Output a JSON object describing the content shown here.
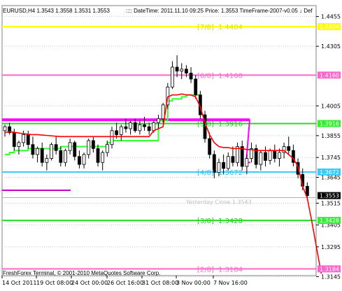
{
  "header": {
    "symbol_line": "EURUSD,H4  1.3543 1.3558 1.3531 1.3553",
    "info_line": ":::: DateTime: 2011.11.10 09:25   Price: 1.3553   TimeFrame-2007-v0.05   ↓  Def"
  },
  "footer": {
    "copyright": "FreshForex Terminal, © 2001-2010 MetaQuotes Software Corp."
  },
  "chart_data": {
    "type": "candlestick",
    "symbol": "EURUSD",
    "timeframe": "H4",
    "ylim": [
      1.315,
      1.451
    ],
    "yticks": [
      1.4455,
      1.4305,
      1.4005,
      1.3855,
      1.3745,
      1.3645,
      1.3515,
      1.3405,
      1.3295,
      1.3145
    ],
    "xticks": [
      "14 Oct 2011",
      "19 Oct 08:00",
      "24 Oct 00:00",
      "26 Oct 16:00",
      "31 Oct 08:00",
      "3 Nov 00:00",
      "7 Nov 16:00"
    ],
    "price_labels": [
      {
        "value": "1.4404",
        "color": "#ffff00",
        "text_color": "#ffffff"
      },
      {
        "value": "1.4160",
        "color": "#ff66cc",
        "text_color": "#ffffff"
      },
      {
        "value": "1.3916",
        "color": "#33ee33",
        "text_color": "#ffffff"
      },
      {
        "value": "1.3672",
        "color": "#33ccff",
        "text_color": "#ffffff"
      },
      {
        "value": "1.3553",
        "color": "#000000",
        "text_color": "#ffffff"
      },
      {
        "value": "1.3428",
        "color": "#33ee33",
        "text_color": "#ffffff"
      },
      {
        "value": "1.3184",
        "color": "#ff66cc",
        "text_color": "#ffffff"
      }
    ],
    "murrey_levels": [
      {
        "label": "[7/8]",
        "value": "1.4404",
        "price": 1.4404,
        "color": "#ffff00",
        "text_color": "#dddd00"
      },
      {
        "label": "[6/8]",
        "value": "1.4160",
        "price": 1.416,
        "color": "#ff66cc",
        "text_color": "#ff66cc"
      },
      {
        "label": "[5/8]",
        "value": "1.3916",
        "price": 1.3916,
        "color": "#22dd22",
        "text_color": "#22cc22"
      },
      {
        "label": "[4/8]",
        "value": "1.3672",
        "price": 1.3672,
        "color": "#33ccff",
        "text_color": "#33bbee"
      },
      {
        "label": "[3/8]",
        "value": "1.3428",
        "price": 1.3428,
        "color": "#22dd22",
        "text_color": "#22cc22"
      },
      {
        "label": "[2/8]",
        "value": "1.3184",
        "price": 1.3184,
        "color": "#ff66cc",
        "text_color": "#ff66cc"
      }
    ],
    "yesterday_close": {
      "label": "Yesterday Close",
      "value": "1.3543",
      "price": 1.3543
    },
    "magenta_level": 1.3935,
    "candles": [
      [
        1.388,
        1.391,
        1.385,
        1.39
      ],
      [
        1.39,
        1.392,
        1.386,
        1.387
      ],
      [
        1.387,
        1.389,
        1.378,
        1.38
      ],
      [
        1.38,
        1.383,
        1.376,
        1.382
      ],
      [
        1.382,
        1.388,
        1.38,
        1.386
      ],
      [
        1.386,
        1.388,
        1.379,
        1.381
      ],
      [
        1.381,
        1.385,
        1.374,
        1.376
      ],
      [
        1.376,
        1.38,
        1.372,
        1.379
      ],
      [
        1.379,
        1.382,
        1.37,
        1.372
      ],
      [
        1.372,
        1.376,
        1.368,
        1.374
      ],
      [
        1.374,
        1.382,
        1.373,
        1.381
      ],
      [
        1.381,
        1.385,
        1.376,
        1.378
      ],
      [
        1.378,
        1.38,
        1.37,
        1.372
      ],
      [
        1.372,
        1.379,
        1.37,
        1.378
      ],
      [
        1.378,
        1.384,
        1.376,
        1.382
      ],
      [
        1.382,
        1.383,
        1.373,
        1.375
      ],
      [
        1.375,
        1.378,
        1.369,
        1.371
      ],
      [
        1.371,
        1.377,
        1.369,
        1.376
      ],
      [
        1.376,
        1.384,
        1.374,
        1.383
      ],
      [
        1.383,
        1.385,
        1.377,
        1.379
      ],
      [
        1.379,
        1.381,
        1.37,
        1.372
      ],
      [
        1.372,
        1.378,
        1.368,
        1.377
      ],
      [
        1.377,
        1.383,
        1.375,
        1.381
      ],
      [
        1.381,
        1.39,
        1.379,
        1.388
      ],
      [
        1.388,
        1.392,
        1.384,
        1.386
      ],
      [
        1.386,
        1.391,
        1.383,
        1.39
      ],
      [
        1.39,
        1.394,
        1.387,
        1.389
      ],
      [
        1.389,
        1.393,
        1.386,
        1.392
      ],
      [
        1.392,
        1.394,
        1.387,
        1.388
      ],
      [
        1.388,
        1.393,
        1.386,
        1.391
      ],
      [
        1.391,
        1.395,
        1.388,
        1.39
      ],
      [
        1.39,
        1.392,
        1.386,
        1.388
      ],
      [
        1.388,
        1.393,
        1.387,
        1.392
      ],
      [
        1.392,
        1.396,
        1.389,
        1.394
      ],
      [
        1.394,
        1.402,
        1.392,
        1.401
      ],
      [
        1.401,
        1.412,
        1.399,
        1.41
      ],
      [
        1.41,
        1.423,
        1.409,
        1.42
      ],
      [
        1.42,
        1.426,
        1.415,
        1.418
      ],
      [
        1.418,
        1.422,
        1.414,
        1.419
      ],
      [
        1.419,
        1.421,
        1.415,
        1.417
      ],
      [
        1.417,
        1.42,
        1.412,
        1.414
      ],
      [
        1.414,
        1.416,
        1.404,
        1.406
      ],
      [
        1.406,
        1.408,
        1.394,
        1.396
      ],
      [
        1.396,
        1.398,
        1.382,
        1.384
      ],
      [
        1.384,
        1.387,
        1.374,
        1.376
      ],
      [
        1.376,
        1.378,
        1.364,
        1.367
      ],
      [
        1.367,
        1.374,
        1.365,
        1.372
      ],
      [
        1.372,
        1.376,
        1.366,
        1.369
      ],
      [
        1.369,
        1.377,
        1.368,
        1.375
      ],
      [
        1.375,
        1.38,
        1.37,
        1.372
      ],
      [
        1.372,
        1.382,
        1.37,
        1.38
      ],
      [
        1.38,
        1.383,
        1.368,
        1.37
      ],
      [
        1.37,
        1.376,
        1.366,
        1.374
      ],
      [
        1.374,
        1.382,
        1.372,
        1.379
      ],
      [
        1.379,
        1.381,
        1.369,
        1.371
      ],
      [
        1.371,
        1.378,
        1.368,
        1.377
      ],
      [
        1.377,
        1.38,
        1.37,
        1.373
      ],
      [
        1.373,
        1.379,
        1.371,
        1.378
      ],
      [
        1.378,
        1.381,
        1.372,
        1.374
      ],
      [
        1.374,
        1.379,
        1.37,
        1.377
      ],
      [
        1.377,
        1.382,
        1.374,
        1.38
      ],
      [
        1.38,
        1.385,
        1.376,
        1.378
      ],
      [
        1.378,
        1.381,
        1.37,
        1.372
      ],
      [
        1.372,
        1.374,
        1.364,
        1.366
      ],
      [
        1.366,
        1.369,
        1.358,
        1.36
      ],
      [
        1.36,
        1.362,
        1.353,
        1.3553
      ]
    ],
    "red_line": [
      1.387,
      1.3875,
      1.3872,
      1.3868,
      1.3865,
      1.3862,
      1.386,
      1.386,
      1.3858,
      1.3856,
      1.3854,
      1.3852,
      1.385,
      1.385,
      1.385,
      1.385,
      1.385,
      1.385,
      1.385,
      1.385,
      1.385,
      1.385,
      1.385,
      1.385,
      1.385,
      1.385,
      1.385,
      1.385,
      1.385,
      1.385,
      1.385,
      1.385,
      1.388,
      1.389,
      1.39,
      1.405,
      1.406,
      1.406,
      1.4065,
      1.406,
      1.406,
      1.405,
      1.4,
      1.392,
      1.386,
      1.382,
      1.38,
      1.3795,
      1.3795,
      1.379,
      1.379,
      1.379,
      1.3785,
      1.3785,
      1.378,
      1.378,
      1.378,
      1.378,
      1.378,
      1.378,
      1.378,
      1.376,
      1.374,
      1.37,
      1.36,
      1.354,
      1.342,
      1.329,
      1.316
    ],
    "green_line": [
      1.376,
      1.377,
      1.378,
      1.378,
      1.378,
      1.379,
      1.379,
      1.379,
      1.379,
      1.379,
      1.379,
      1.379,
      1.38,
      1.38,
      1.38,
      1.38,
      1.38,
      1.38,
      1.38,
      1.38,
      1.38,
      1.38,
      1.382,
      1.383,
      1.383,
      1.383,
      1.383,
      1.383,
      1.383,
      1.383,
      1.383,
      1.383,
      1.383,
      1.393,
      1.393,
      1.403,
      1.404,
      1.404,
      1.405,
      1.406,
      1.406,
      1.406,
      1.406,
      null,
      null,
      null,
      null,
      null,
      null,
      null,
      null,
      null,
      null,
      null,
      null,
      null,
      null,
      null,
      null,
      null,
      null,
      null,
      null,
      null,
      null,
      null,
      null,
      null,
      null
    ]
  }
}
